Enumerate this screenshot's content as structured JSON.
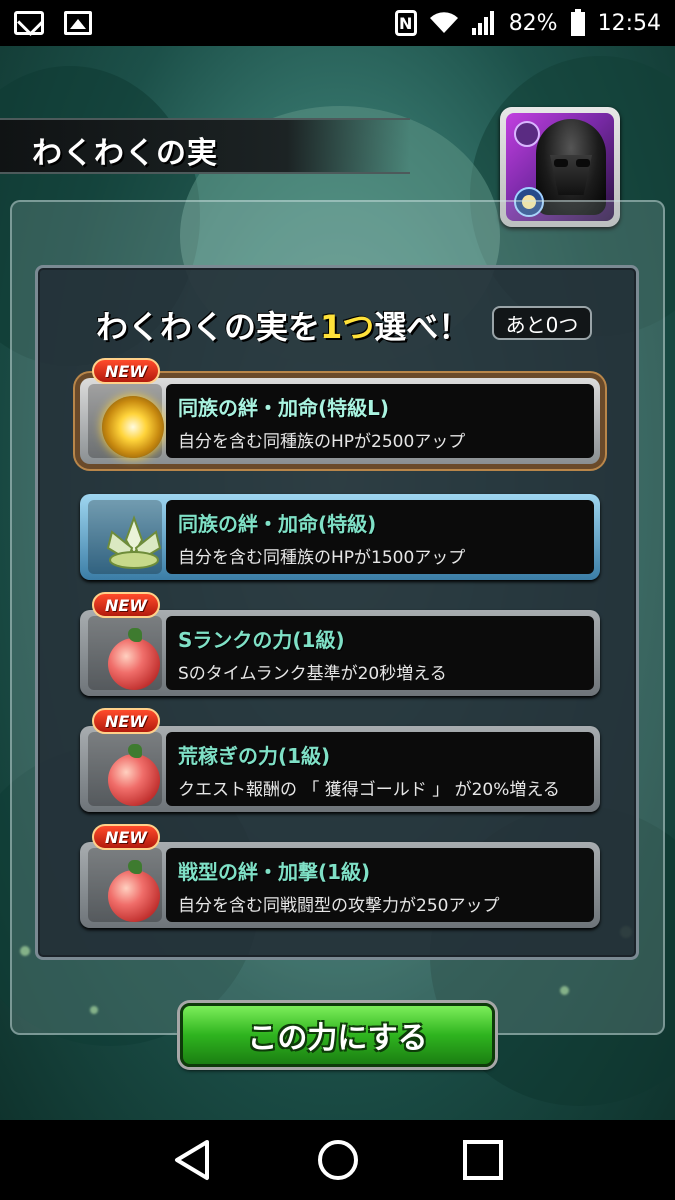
{
  "status_bar": {
    "battery_percent": "82%",
    "time": "12:54",
    "icons": [
      "mail-icon",
      "gallery-icon",
      "nfc-icon",
      "wifi-icon",
      "signal-icon",
      "battery-icon"
    ],
    "nfc_letter": "N"
  },
  "header": {
    "title": "わくわくの実"
  },
  "panel": {
    "heading_prefix": "わくわくの実を",
    "heading_number": "1つ",
    "heading_suffix": "選べ！",
    "remaining": "あと0つ"
  },
  "options": [
    {
      "badge": "NEW",
      "title": "同族の絆・加命(特級L)",
      "desc": "自分を含む同種族のHPが2500アップ",
      "icon": "golden-sun-icon",
      "state": "selected"
    },
    {
      "badge": "",
      "title": "同族の絆・加命(特級)",
      "desc": "自分を含む同種族のHPが1500アップ",
      "icon": "lotus-icon",
      "state": "blue"
    },
    {
      "badge": "NEW",
      "title": "Sランクの力(1級)",
      "desc": "Sのタイムランク基準が20秒増える",
      "icon": "red-fruit-icon",
      "state": "normal"
    },
    {
      "badge": "NEW",
      "title": "荒稼ぎの力(1級)",
      "desc": "クエスト報酬の 「 獲得ゴールド 」 が20%増える",
      "icon": "red-fruit-icon",
      "state": "normal"
    },
    {
      "badge": "NEW",
      "title": "戦型の絆・加撃(1級)",
      "desc": "自分を含む同戦闘型の攻撃力が250アップ",
      "icon": "red-fruit-icon",
      "state": "normal"
    }
  ],
  "confirm_button": {
    "label": "この力にする"
  },
  "navigation": {
    "buttons": [
      "back-icon",
      "home-icon",
      "recent-apps-icon"
    ]
  },
  "colors": {
    "accent_green": "#2fb41f",
    "number_yellow": "#ffe23a",
    "option_title": "#7fe0c6",
    "new_badge_red": "#e2321b"
  }
}
